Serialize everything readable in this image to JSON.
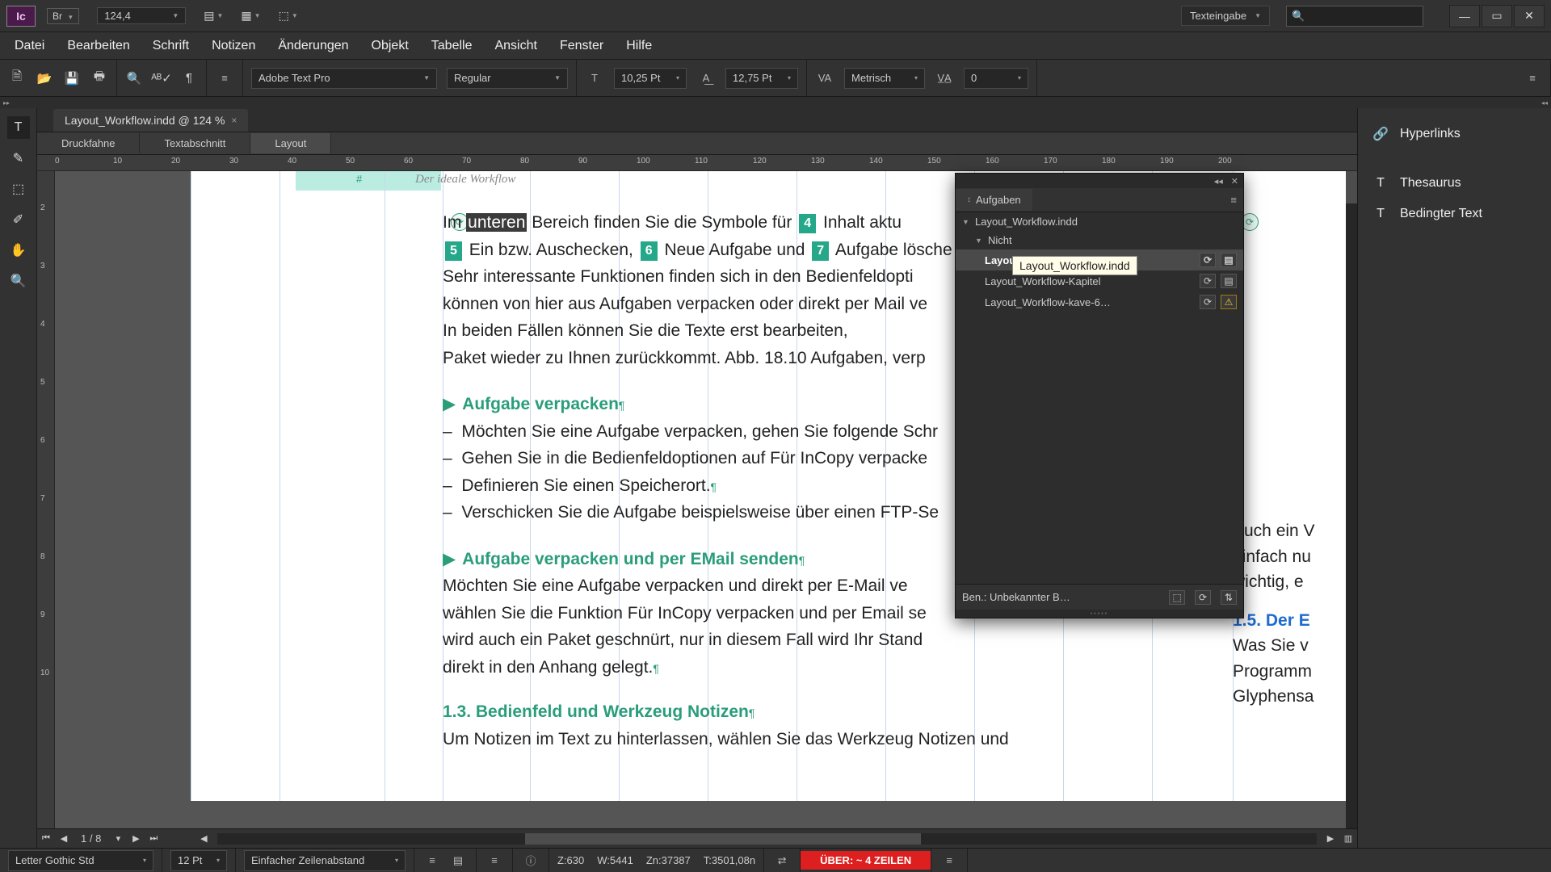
{
  "app": {
    "icon_text": "Ic",
    "br_label": "Br",
    "zoom": "124,4"
  },
  "workspace": {
    "name": "Texteingabe"
  },
  "win": {
    "min": "—",
    "max": "▭",
    "close": "✕"
  },
  "menu": [
    "Datei",
    "Bearbeiten",
    "Schrift",
    "Notizen",
    "Änderungen",
    "Objekt",
    "Tabelle",
    "Ansicht",
    "Fenster",
    "Hilfe"
  ],
  "control": {
    "font": "Adobe Text Pro",
    "style": "Regular",
    "size": "10,25 Pt",
    "leading": "12,75 Pt",
    "kerning": "Metrisch",
    "tracking": "0"
  },
  "doc_tab": "Layout_Workflow.indd @ 124 %",
  "view_tabs": [
    "Druckfahne",
    "Textabschnitt",
    "Layout"
  ],
  "ruler_h": [
    "0",
    "10",
    "20",
    "30",
    "40",
    "50",
    "60",
    "70",
    "80",
    "90",
    "100",
    "110",
    "120",
    "130",
    "140",
    "150",
    "160",
    "170",
    "180",
    "190",
    "200"
  ],
  "ruler_v": [
    "2",
    "3",
    "4",
    "5",
    "6",
    "7",
    "8",
    "9",
    "10"
  ],
  "page": {
    "header_running": "Der ideale Workflow",
    "hash": "#",
    "p1_a": "Im ",
    "p1_b_hl": "unteren",
    "p1_c": " Bereich finden Sie die Symbole für ",
    "p1_n4": "4",
    "p1_d": " Inhalt aktu",
    "p2_n5": "5",
    "p2_a": " Ein bzw. Auschecken, ",
    "p2_n6": "6",
    "p2_b": " Neue Aufgabe und ",
    "p2_n7": "7",
    "p2_c": " Aufgabe lösche",
    "p3": "Sehr interessante Funktionen finden sich in den Bedienfeldopti",
    "p4": "können von hier aus Aufgaben verpacken oder direkt per Mail ve",
    "p5": "In beiden Fällen können Sie die Texte erst bearbeiten,",
    "p6": "Paket wieder zu Ihnen zurückkommt. Abb. 18.10 Aufgaben, verp",
    "h1": "Aufgabe verpacken",
    "l1": "Möchten Sie eine Aufgabe verpacken, gehen Sie folgende Schr",
    "l2": "Gehen Sie in die Bedienfeldoptionen auf Für InCopy verpacke",
    "l3": "Definieren Sie einen Speicherort.",
    "l4": "Verschicken Sie die Aufgabe beispielsweise über einen FTP-Se",
    "h2": "Aufgabe verpacken und per EMail senden",
    "q1": "Möchten Sie eine Aufgabe verpacken und direkt per E-Mail ve",
    "q2": "wählen Sie die Funktion Für InCopy verpacken und per Email se",
    "q3": "wird auch ein Paket geschnürt, nur in diesem Fall wird Ihr Stand",
    "q4": "direkt in den Anhang gelegt.",
    "h3": "1.3.   Bedienfeld und Werkzeug Notizen",
    "r1": "Um Notizen im Text zu hinterlassen, wählen Sie das Werkzeug Notizen und",
    "rc1": "Auch ein V",
    "rc2": "einfach nu",
    "rc3": "wichtig, e",
    "rc_h": "1.5.   Der E",
    "rc4": "Was Sie v",
    "rc5": "Programm",
    "rc6": "Glyphensa"
  },
  "aufgaben": {
    "title": "Aufgaben",
    "root": "Layout_Workflow.indd",
    "nicht": "Nicht",
    "tooltip": "Layout_Workflow.indd",
    "row1": "Layout_Workflow-Str…",
    "row2": "Layout_Workflow-Kapitel",
    "row3": "Layout_Workflow-kave-6…",
    "footer_user": "Ben.: Unbekannter B…"
  },
  "right_panels": [
    "Hyperlinks",
    "Thesaurus",
    "Bedingter Text"
  ],
  "hnav": {
    "page": "1",
    "slash": "/",
    "total": "8"
  },
  "status": {
    "font": "Letter Gothic Std",
    "size": "12 Pt",
    "spacing_label": "Einfacher Zeilenabstand",
    "z": "Z:630",
    "w": "W:5441",
    "zn": "Zn:37387",
    "t": "T:3501,08n",
    "overset": "ÜBER:  ~ 4 ZEILEN"
  }
}
